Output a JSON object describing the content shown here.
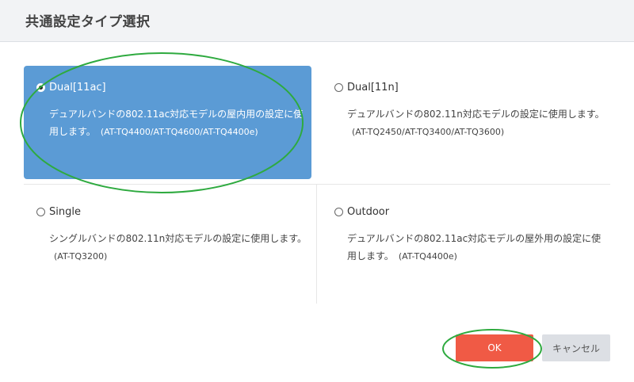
{
  "dialog": {
    "title": "共通設定タイプ選択"
  },
  "options": [
    {
      "label": "Dual[11ac]",
      "description": "デュアルバンドの802.11ac対応モデルの屋内用の設定に使用します。",
      "models": "(AT-TQ4400/AT-TQ4600/AT-TQ4400e)",
      "selected": true
    },
    {
      "label": "Dual[11n]",
      "description": "デュアルバンドの802.11n対応モデルの設定に使用します。",
      "models": "(AT-TQ2450/AT-TQ3400/AT-TQ3600)",
      "selected": false
    },
    {
      "label": "Single",
      "description": "シングルバンドの802.11n対応モデルの設定に使用します。",
      "models": "(AT-TQ3200)",
      "selected": false
    },
    {
      "label": "Outdoor",
      "description": "デュアルバンドの802.11ac対応モデルの屋外用の設定に使用します。",
      "models": "(AT-TQ4400e)",
      "selected": false
    }
  ],
  "buttons": {
    "ok_label": "OK",
    "cancel_label": "キャンセル"
  },
  "colors": {
    "selected_bg": "#5b9bd5",
    "ok_bg": "#f05a45",
    "cancel_bg": "#dcdfe4",
    "annotation": "#2eaa3f"
  }
}
